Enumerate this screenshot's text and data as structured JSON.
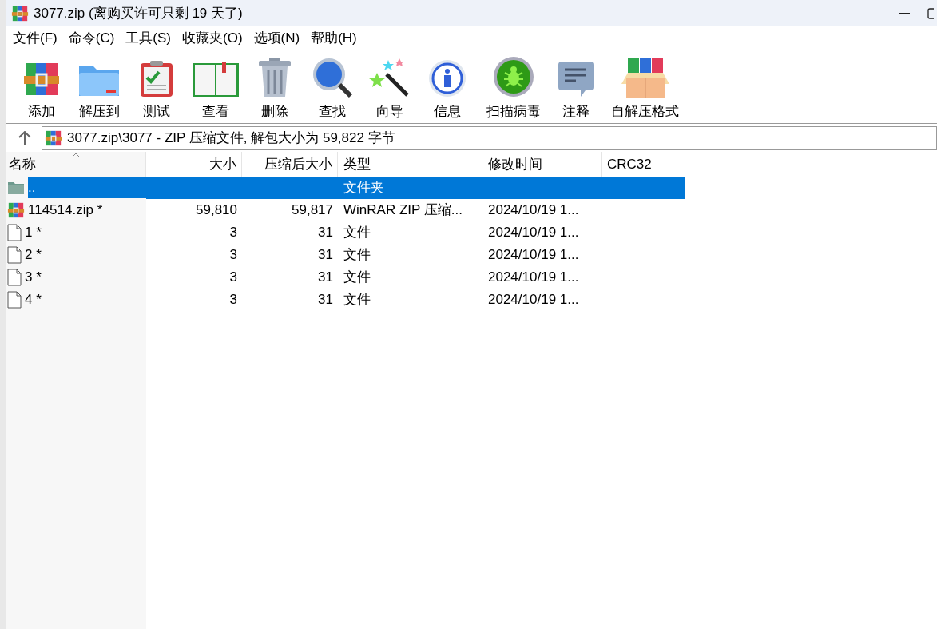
{
  "window": {
    "title": "3077.zip (离购买许可只剩 19 天了)"
  },
  "menu": [
    "文件(F)",
    "命令(C)",
    "工具(S)",
    "收藏夹(O)",
    "选项(N)",
    "帮助(H)"
  ],
  "toolbar_groups": [
    [
      "添加",
      "解压到",
      "测试",
      "查看",
      "删除",
      "查找",
      "向导",
      "信息"
    ],
    [
      "扫描病毒",
      "注释",
      "自解压格式"
    ]
  ],
  "address_bar": {
    "path": "3077.zip\\3077 - ZIP 压缩文件, 解包大小为 59,822 字节"
  },
  "table": {
    "columns": [
      "名称",
      "大小",
      "压缩后大小",
      "类型",
      "修改时间",
      "CRC32"
    ],
    "rows": [
      {
        "kind": "folder",
        "selected": true,
        "cells": [
          "..",
          "",
          "",
          "文件夹",
          "",
          ""
        ]
      },
      {
        "kind": "archive",
        "selected": false,
        "cells": [
          "114514.zip *",
          "59,810",
          "59,817",
          "WinRAR ZIP 压缩...",
          "2024/10/19 1...",
          ""
        ]
      },
      {
        "kind": "file",
        "selected": false,
        "cells": [
          "1 *",
          "3",
          "31",
          "文件",
          "2024/10/19 1...",
          ""
        ]
      },
      {
        "kind": "file",
        "selected": false,
        "cells": [
          "2 *",
          "3",
          "31",
          "文件",
          "2024/10/19 1...",
          ""
        ]
      },
      {
        "kind": "file",
        "selected": false,
        "cells": [
          "3 *",
          "3",
          "31",
          "文件",
          "2024/10/19 1...",
          ""
        ]
      },
      {
        "kind": "file",
        "selected": false,
        "cells": [
          "4 *",
          "3",
          "31",
          "文件",
          "2024/10/19 1...",
          ""
        ]
      }
    ]
  }
}
